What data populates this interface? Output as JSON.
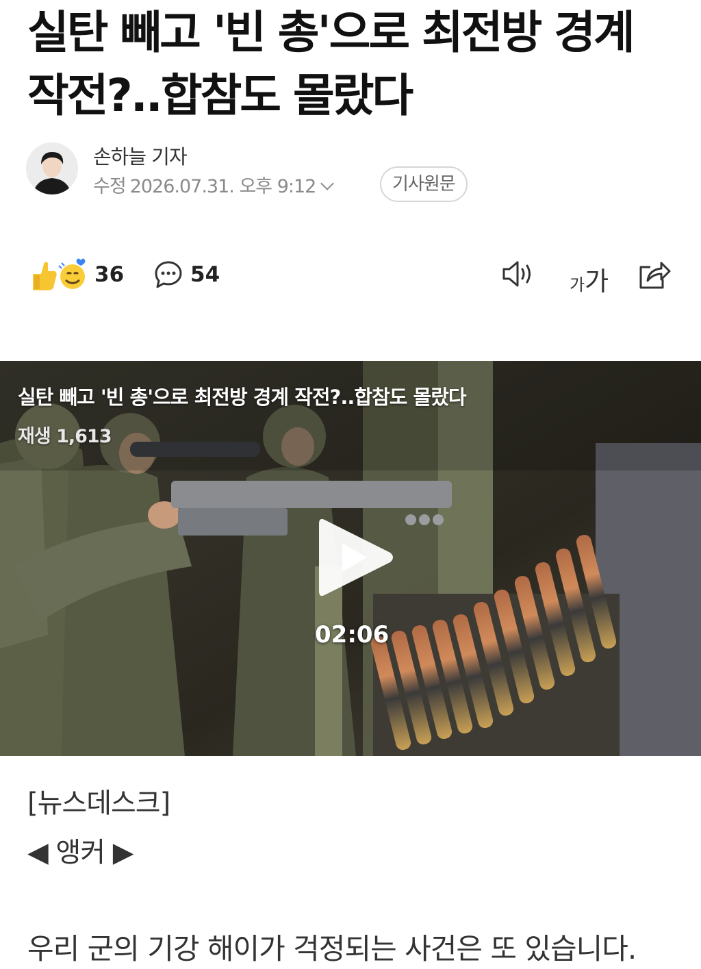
{
  "article": {
    "headline": "실탄 빼고 '빈 총'으로 최전방 경계 작전?..합참도 몰랐다",
    "author": "손하늘 기자",
    "updated_label": "수정",
    "updated_time": "2026.07.31. 오후 9:12",
    "original_button": "기사원문",
    "section_tag": "[뉴스데스크]",
    "anchor_line": "◀ 앵커 ▶",
    "first_paragraph": "우리 군의 기강 해이가 걱정되는 사건은 또 있습니다."
  },
  "toolbar": {
    "reaction_count": "36",
    "comment_count": "54",
    "font_small": "가",
    "font_big": "가",
    "icons": [
      "reaction-emoji-icon",
      "comment-icon",
      "speaker-icon",
      "font-size-icon",
      "share-icon"
    ]
  },
  "video": {
    "title": "실탄 빼고 '빈 총'으로 최전방 경계 작전?..합참도 몰랐다",
    "views_label": "재생",
    "views": "1,613",
    "duration": "02:06"
  },
  "colors": {
    "text": "#111111",
    "muted": "#8a8a8a",
    "video_bg": "#2c2a22"
  }
}
